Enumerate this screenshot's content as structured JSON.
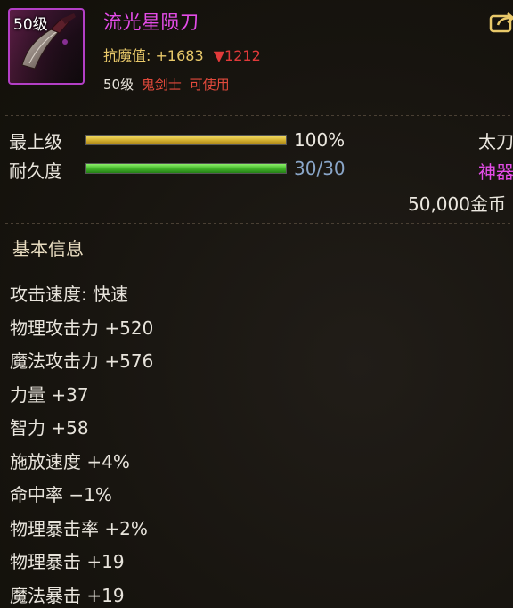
{
  "item": {
    "level_badge": "50级",
    "name": "流光星陨刀",
    "resist_label": "抗魔值:",
    "resist_value": "+1683",
    "resist_down": "▼1212",
    "required_level": "50级",
    "required_class": "鬼剑士",
    "usable_text": "可使用",
    "icon": "sword-item-icon",
    "share_icon": "share-icon"
  },
  "bars": [
    {
      "label": "最上级",
      "value_text": "100%",
      "progress": 1.0,
      "style": "gold"
    },
    {
      "label": "耐久度",
      "value_text": "30/30",
      "progress": 1.0,
      "style": "green"
    }
  ],
  "right_column": {
    "weapon_type": "太刀",
    "rarity": "神器",
    "price": "50,000金币"
  },
  "section": {
    "title": "基本信息"
  },
  "stats": [
    "攻击速度: 快速",
    "物理攻击力 +520",
    "魔法攻击力 +576",
    "力量 +37",
    "智力 +58",
    "施放速度 +4%",
    "命中率 −1%",
    "物理暴击率 +2%",
    "物理暴击 +19",
    "魔法暴击 +19"
  ],
  "colors": {
    "rarity_purple": "#e44ce8",
    "gold": "#e9c96a",
    "red": "#e13a3a",
    "blue": "#8aa6c8"
  }
}
